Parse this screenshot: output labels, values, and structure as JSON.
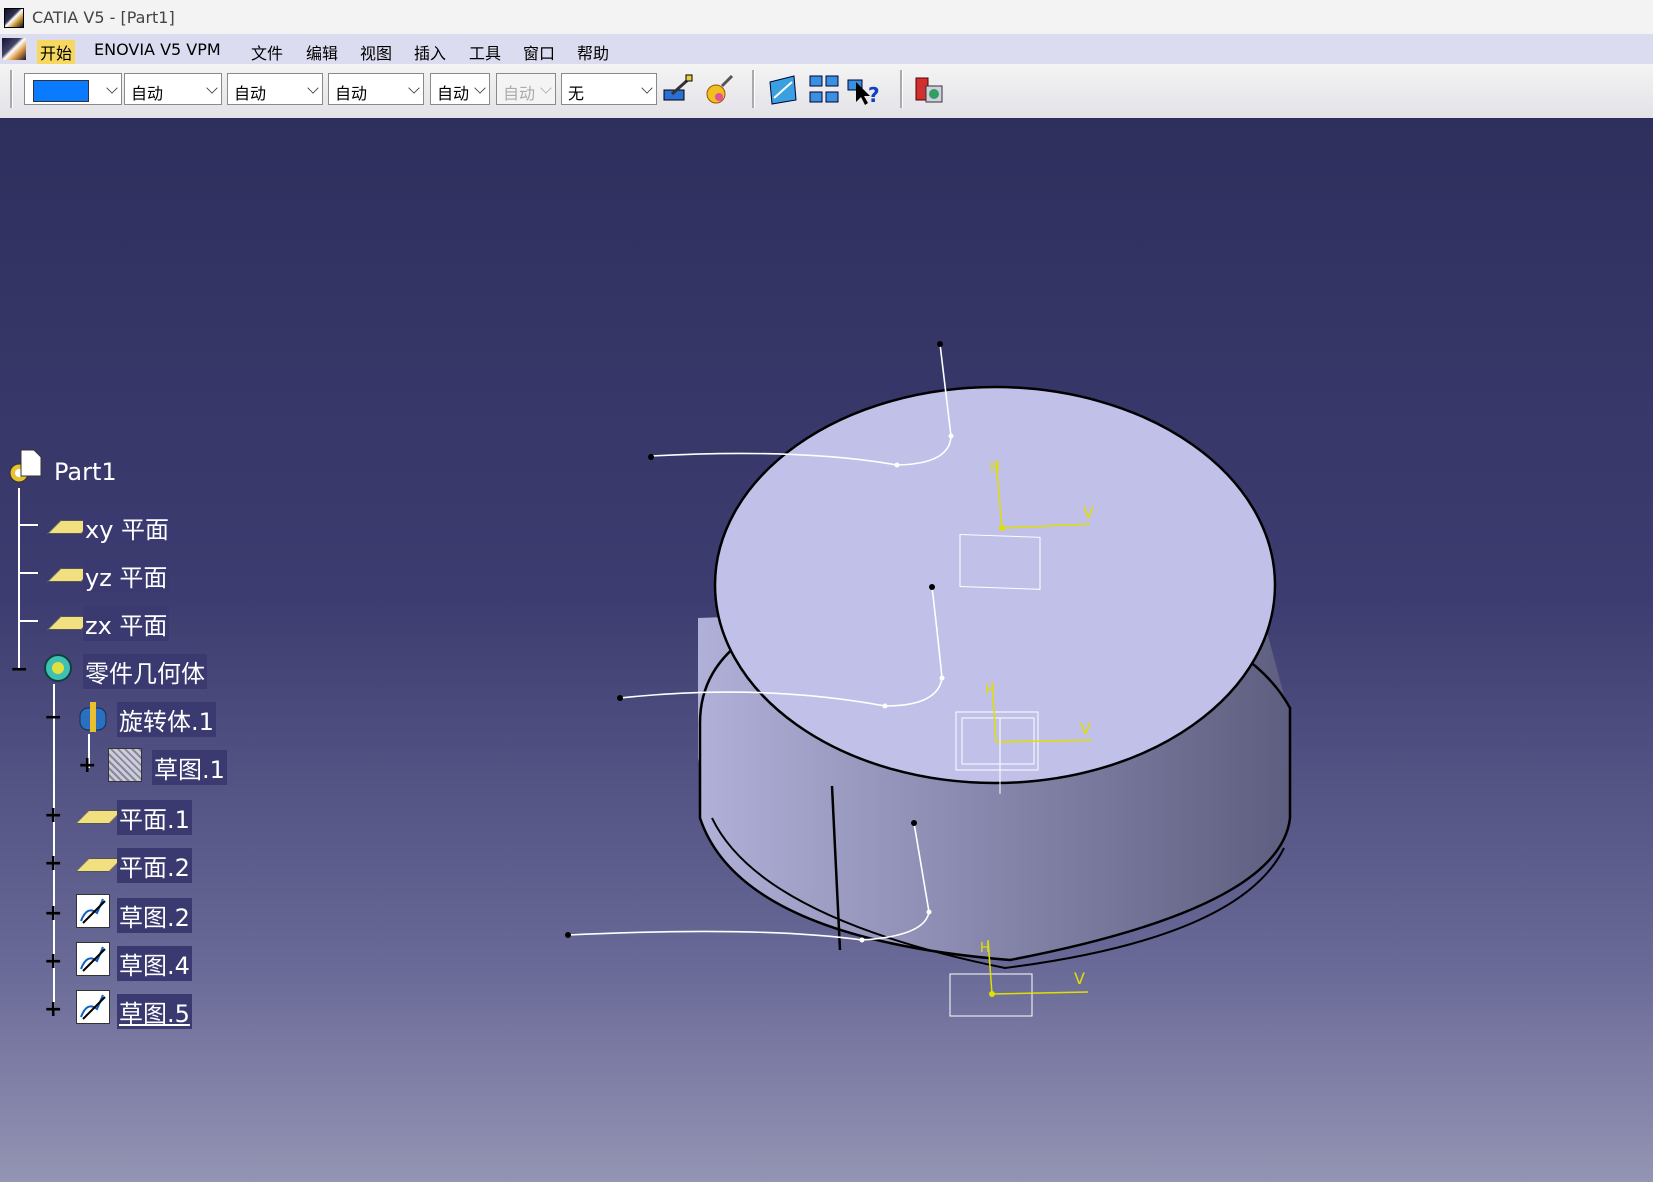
{
  "window": {
    "title": "CATIA V5 - [Part1]"
  },
  "menu": {
    "items": [
      "开始",
      "ENOVIA V5 VPM",
      "文件",
      "编辑",
      "视图",
      "插入",
      "工具",
      "窗口",
      "帮助"
    ]
  },
  "toolbar": {
    "color_swatch": "#0a7bff",
    "combos": [
      "自动",
      "自动",
      "自动",
      "自动",
      "自动",
      "无"
    ],
    "icons": [
      "paintbrush-icon",
      "apply-material-icon",
      "view-icon",
      "quick-view-icon",
      "whats-this-icon",
      "catalog-icon"
    ]
  },
  "tree": {
    "root": "Part1",
    "nodes": [
      {
        "label": "xy 平面"
      },
      {
        "label": "yz 平面"
      },
      {
        "label": "zx 平面"
      },
      {
        "label": "零件几何体"
      },
      {
        "label": "旋转体.1"
      },
      {
        "label": "草图.1"
      },
      {
        "label": "平面.1"
      },
      {
        "label": "平面.2"
      },
      {
        "label": "草图.2"
      },
      {
        "label": "草图.4"
      },
      {
        "label": "草图.5"
      }
    ]
  },
  "axes": {
    "h": "H",
    "v": "V"
  }
}
